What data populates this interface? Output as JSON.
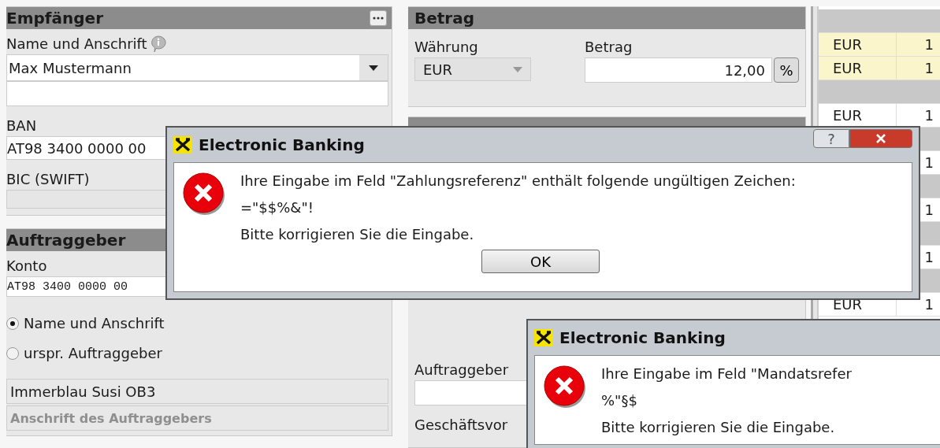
{
  "recipient_panel": {
    "title": "Empfänger",
    "name_label": "Name und Anschrift",
    "name_value": "Max Mustermann",
    "iban_label": "BAN",
    "iban_value": "AT98 3400 0000 00",
    "bic_label": "BIC (SWIFT)"
  },
  "originator_panel": {
    "title": "Auftraggeber",
    "account_label": "Konto",
    "account_value": "AT98 3400 0000 00",
    "options": [
      {
        "label": "Name und Anschrift",
        "selected": true
      },
      {
        "label": "urspr. Auftraggeber",
        "selected": false
      }
    ],
    "name_value": "Immerblau Susi OB3",
    "address_placeholder": "Anschrift des Auftraggebers"
  },
  "amount_panel": {
    "title": "Betrag",
    "currency_label": "Währung",
    "currency_value": "EUR",
    "amount_label": "Betrag",
    "amount_value": "12,00",
    "percent_button": "%"
  },
  "details_panel": {
    "originator_label": "Auftraggeber",
    "business_label": "Geschäftsvor"
  },
  "orders_table": {
    "rows": [
      {
        "kind": "group"
      },
      {
        "kind": "row",
        "highlighted": true,
        "currency": "EUR",
        "amount": "1"
      },
      {
        "kind": "row",
        "highlighted": true,
        "currency": "EUR",
        "amount": "1"
      },
      {
        "kind": "group"
      },
      {
        "kind": "row",
        "highlighted": false,
        "currency": "EUR",
        "amount": "1"
      },
      {
        "kind": "group"
      },
      {
        "kind": "row",
        "highlighted": false,
        "amount": "1"
      },
      {
        "kind": "group"
      },
      {
        "kind": "row",
        "highlighted": false,
        "amount": "1"
      },
      {
        "kind": "group"
      },
      {
        "kind": "row",
        "highlighted": false,
        "amount": "1"
      },
      {
        "kind": "group"
      },
      {
        "kind": "row",
        "highlighted": false,
        "currency": "EUR",
        "amount": "1"
      }
    ]
  },
  "dialogs": [
    {
      "title": "Electronic Banking",
      "help_button": "?",
      "lines": [
        "Ihre Eingabe im Feld \"Zahlungsreferenz\" enthält folgende ungültigen Zeichen:",
        "=\"$$%&\"!",
        "Bitte korrigieren Sie die Eingabe."
      ],
      "button": "OK"
    },
    {
      "title": "Electronic Banking",
      "lines": [
        "Ihre Eingabe im Feld \"Mandatsrefer",
        "%\"§$",
        "Bitte korrigieren Sie die Eingabe."
      ]
    }
  ]
}
